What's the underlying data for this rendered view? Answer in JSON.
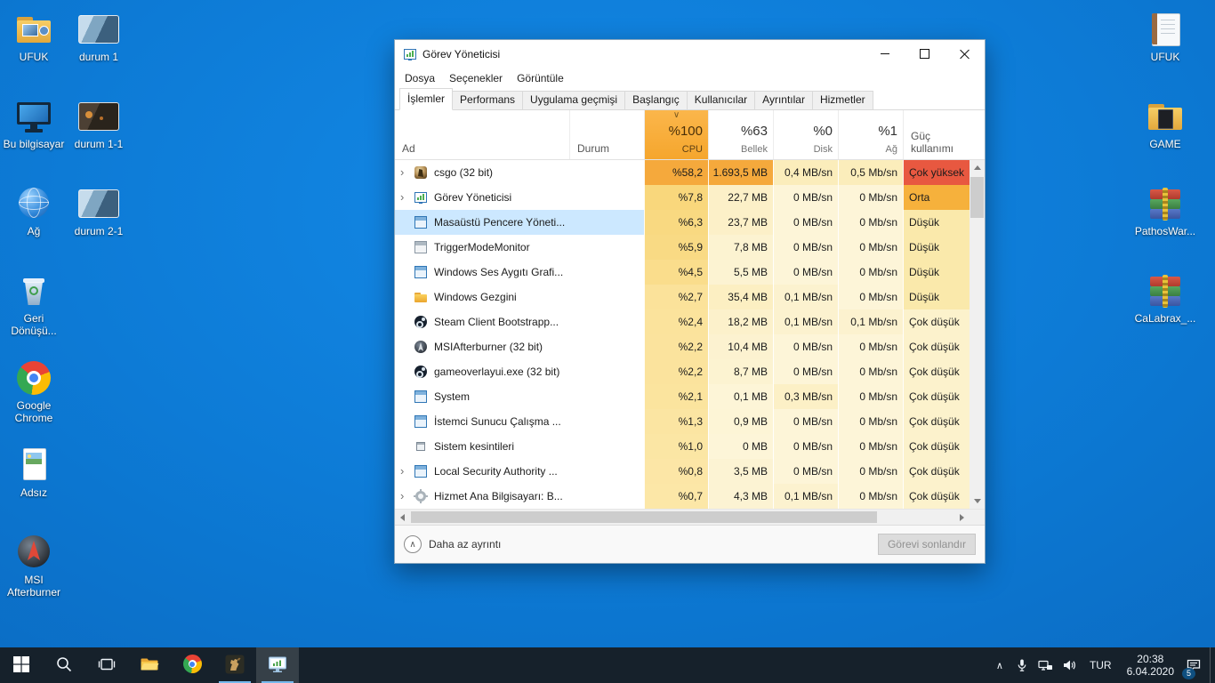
{
  "desktop": {
    "column1": [
      {
        "label": "UFUK",
        "icon": "user-folder"
      },
      {
        "label": "Bu bilgisayar",
        "icon": "this-pc"
      },
      {
        "label": "Ağ",
        "icon": "network-globe"
      },
      {
        "label": "Geri Dönüşü...",
        "icon": "recycle-bin"
      },
      {
        "label": "Google Chrome",
        "icon": "chrome"
      },
      {
        "label": "Adsız",
        "icon": "image-file"
      },
      {
        "label": "MSI Afterburner",
        "icon": "msi-afterburner"
      }
    ],
    "column2": [
      {
        "label": "durum 1",
        "icon": "screenshot"
      },
      {
        "label": "durum 1-1",
        "icon": "screenshot-dark"
      },
      {
        "label": "durum 2-1",
        "icon": "screenshot"
      }
    ],
    "right_column": [
      {
        "label": "UFUK",
        "icon": "notebook"
      },
      {
        "label": "GAME",
        "icon": "game-folder"
      },
      {
        "label": "PathosWar...",
        "icon": "winrar-archive"
      },
      {
        "label": "CaLabrax_...",
        "icon": "winrar-archive"
      }
    ]
  },
  "taskmanager": {
    "title": "Görev Yöneticisi",
    "menu": [
      "Dosya",
      "Seçenekler",
      "Görüntüle"
    ],
    "tabs": [
      {
        "label": "İşlemler",
        "active": true
      },
      {
        "label": "Performans"
      },
      {
        "label": "Uygulama geçmişi"
      },
      {
        "label": "Başlangıç"
      },
      {
        "label": "Kullanıcılar"
      },
      {
        "label": "Ayrıntılar"
      },
      {
        "label": "Hizmetler"
      }
    ],
    "columns": {
      "name": "Ad",
      "status": "Durum",
      "cpu_pct": "%100",
      "cpu_label": "CPU",
      "mem_pct": "%63",
      "mem_label": "Bellek",
      "disk_pct": "%0",
      "disk_label": "Disk",
      "net_pct": "%1",
      "net_label": "Ağ",
      "power_label": "Güç kullanımı"
    },
    "glyphs": {
      "sort": "∨",
      "expand": "›",
      "less_chevron": "∧"
    },
    "rows": [
      {
        "name": "csgo (32 bit)",
        "icon": "csgo",
        "expand": true,
        "cells": [
          {
            "t": "%58,2",
            "bg": "#f5a93c"
          },
          {
            "t": "1.693,5 MB",
            "bg": "#f5a93c"
          },
          {
            "t": "0,4 MB/sn",
            "bg": "#fbedbb"
          },
          {
            "t": "0,5 Mb/sn",
            "bg": "#fbedbb"
          },
          {
            "t": "Çok yüksek",
            "bg": "#e85840"
          }
        ]
      },
      {
        "name": "Görev Yöneticisi",
        "icon": "taskmgr",
        "expand": true,
        "cells": [
          {
            "t": "%7,8",
            "bg": "#f9d77c"
          },
          {
            "t": "22,7 MB",
            "bg": "#fcf0c8"
          },
          {
            "t": "0 MB/sn",
            "bg": "#fdf5d8"
          },
          {
            "t": "0 Mb/sn",
            "bg": "#fdf5d8"
          },
          {
            "t": "Orta",
            "bg": "#f6b13c"
          }
        ]
      },
      {
        "name": "Masaüstü Pencere Yöneti...",
        "icon": "window",
        "selected": true,
        "cells": [
          {
            "t": "%6,3",
            "bg": "#f9d981"
          },
          {
            "t": "23,7 MB",
            "bg": "#fcf0c8"
          },
          {
            "t": "0 MB/sn",
            "bg": "#fdf5d8"
          },
          {
            "t": "0 Mb/sn",
            "bg": "#fdf5d8"
          },
          {
            "t": "Düşük",
            "bg": "#fae9ab"
          }
        ]
      },
      {
        "name": "TriggerModeMonitor",
        "icon": "window-gray",
        "cells": [
          {
            "t": "%5,9",
            "bg": "#f9da84"
          },
          {
            "t": "7,8 MB",
            "bg": "#fcf3d1"
          },
          {
            "t": "0 MB/sn",
            "bg": "#fdf5d8"
          },
          {
            "t": "0 Mb/sn",
            "bg": "#fdf5d8"
          },
          {
            "t": "Düşük",
            "bg": "#fae9ab"
          }
        ]
      },
      {
        "name": "Windows Ses Aygıtı Grafi...",
        "icon": "window",
        "cells": [
          {
            "t": "%4,5",
            "bg": "#fadd8c"
          },
          {
            "t": "5,5 MB",
            "bg": "#fcf3d2"
          },
          {
            "t": "0 MB/sn",
            "bg": "#fdf5d8"
          },
          {
            "t": "0 Mb/sn",
            "bg": "#fdf5d8"
          },
          {
            "t": "Düşük",
            "bg": "#fae9ab"
          }
        ]
      },
      {
        "name": "Windows Gezgini",
        "icon": "folder",
        "cells": [
          {
            "t": "%2,7",
            "bg": "#fbe29a"
          },
          {
            "t": "35,4 MB",
            "bg": "#fcefc2"
          },
          {
            "t": "0,1 MB/sn",
            "bg": "#fcf2cf"
          },
          {
            "t": "0 Mb/sn",
            "bg": "#fdf5d8"
          },
          {
            "t": "Düşük",
            "bg": "#fae9ab"
          }
        ]
      },
      {
        "name": "Steam Client Bootstrapp...",
        "icon": "steam",
        "cells": [
          {
            "t": "%2,4",
            "bg": "#fbe39c"
          },
          {
            "t": "18,2 MB",
            "bg": "#fcf1cb"
          },
          {
            "t": "0,1 MB/sn",
            "bg": "#fcf2cf"
          },
          {
            "t": "0,1 Mb/sn",
            "bg": "#fcf2cf"
          },
          {
            "t": "Çok düşük",
            "bg": "#fcf2cc"
          }
        ]
      },
      {
        "name": "MSIAfterburner (32 bit)",
        "icon": "msi",
        "cells": [
          {
            "t": "%2,2",
            "bg": "#fbe39d"
          },
          {
            "t": "10,4 MB",
            "bg": "#fcf2d0"
          },
          {
            "t": "0 MB/sn",
            "bg": "#fdf5d8"
          },
          {
            "t": "0 Mb/sn",
            "bg": "#fdf5d8"
          },
          {
            "t": "Çok düşük",
            "bg": "#fcf2cc"
          }
        ]
      },
      {
        "name": "gameoverlayui.exe (32 bit)",
        "icon": "steam",
        "cells": [
          {
            "t": "%2,2",
            "bg": "#fbe39d"
          },
          {
            "t": "8,7 MB",
            "bg": "#fcf3d1"
          },
          {
            "t": "0 MB/sn",
            "bg": "#fdf5d8"
          },
          {
            "t": "0 Mb/sn",
            "bg": "#fdf5d8"
          },
          {
            "t": "Çok düşük",
            "bg": "#fcf2cc"
          }
        ]
      },
      {
        "name": "System",
        "icon": "window",
        "cells": [
          {
            "t": "%2,1",
            "bg": "#fbe49e"
          },
          {
            "t": "0,1 MB",
            "bg": "#fdf5d7"
          },
          {
            "t": "0,3 MB/sn",
            "bg": "#fcf0c6"
          },
          {
            "t": "0 Mb/sn",
            "bg": "#fdf5d8"
          },
          {
            "t": "Çok düşük",
            "bg": "#fcf2cc"
          }
        ]
      },
      {
        "name": "İstemci Sunucu Çalışma ...",
        "icon": "window",
        "cells": [
          {
            "t": "%1,3",
            "bg": "#fbe5a2"
          },
          {
            "t": "0,9 MB",
            "bg": "#fdf5d6"
          },
          {
            "t": "0 MB/sn",
            "bg": "#fdf5d8"
          },
          {
            "t": "0 Mb/sn",
            "bg": "#fdf5d8"
          },
          {
            "t": "Çok düşük",
            "bg": "#fcf2cc"
          }
        ]
      },
      {
        "name": "Sistem kesintileri",
        "icon": "window-plain",
        "cells": [
          {
            "t": "%1,0",
            "bg": "#fbe6a4"
          },
          {
            "t": "0 MB",
            "bg": "#fdf5d8"
          },
          {
            "t": "0 MB/sn",
            "bg": "#fdf5d8"
          },
          {
            "t": "0 Mb/sn",
            "bg": "#fdf5d8"
          },
          {
            "t": "Çok düşük",
            "bg": "#fcf2cc"
          }
        ]
      },
      {
        "name": "Local Security Authority ...",
        "icon": "window",
        "expand": true,
        "cells": [
          {
            "t": "%0,8",
            "bg": "#fce6a6"
          },
          {
            "t": "3,5 MB",
            "bg": "#fcf3d3"
          },
          {
            "t": "0 MB/sn",
            "bg": "#fdf5d8"
          },
          {
            "t": "0 Mb/sn",
            "bg": "#fdf5d8"
          },
          {
            "t": "Çok düşük",
            "bg": "#fcf2cc"
          }
        ]
      },
      {
        "name": "Hizmet Ana Bilgisayarı: B...",
        "icon": "gear",
        "expand": true,
        "cells": [
          {
            "t": "%0,7",
            "bg": "#fce7a7"
          },
          {
            "t": "4,3 MB",
            "bg": "#fcf3d3"
          },
          {
            "t": "0,1 MB/sn",
            "bg": "#fcf2cf"
          },
          {
            "t": "0 Mb/sn",
            "bg": "#fdf5d8"
          },
          {
            "t": "Çok düşük",
            "bg": "#fcf2cc"
          }
        ]
      }
    ],
    "footer": {
      "less": "Daha az ayrıntı",
      "end_task": "Görevi sonlandır"
    }
  },
  "taskbar": {
    "items": [
      {
        "icon": "start"
      },
      {
        "icon": "search"
      },
      {
        "icon": "task-view"
      },
      {
        "icon": "explorer"
      },
      {
        "icon": "chrome"
      },
      {
        "icon": "csgo",
        "running": true
      },
      {
        "icon": "task-manager",
        "running": true,
        "active": true
      }
    ],
    "tray_icons": [
      "microphone",
      "network",
      "volume"
    ],
    "tray_chevron": "∧",
    "lang": "TUR",
    "time": "20:38",
    "date": "6.04.2020",
    "notif_badge": "5"
  },
  "colors": {
    "accent": "#0078d7",
    "heat_very_high": "#e85840",
    "heat_medium": "#f6b13c",
    "selection": "#cce8ff",
    "taskbar": "#16212b"
  }
}
